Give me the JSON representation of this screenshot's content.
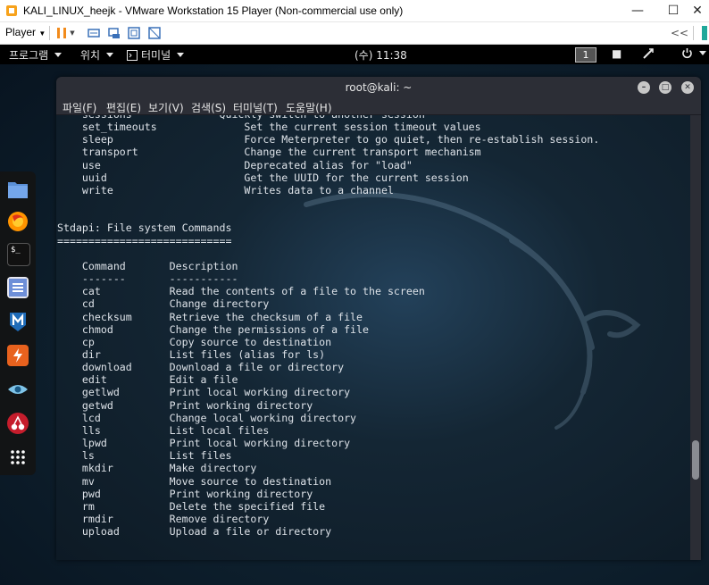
{
  "vmware": {
    "title": "KALI_LINUX_heejk - VMware Workstation 15 Player (Non-commercial use only)",
    "player_label": "Player",
    "icons": [
      "vmware-app-icon",
      "pause-icon",
      "send-ctrl-alt-del-icon",
      "removable-devices-icon",
      "fullscreen-icon",
      "unity-icon",
      "collapse-icon"
    ]
  },
  "gnome": {
    "programs": "프로그램",
    "places": "위치",
    "terminal_app": "터미널",
    "clock": "(수) 11:38",
    "workspace": "1"
  },
  "dock": {
    "icons": [
      "files-icon",
      "firefox-icon",
      "terminal-icon",
      "text-editor-icon",
      "metasploit-icon",
      "burpsuite-icon",
      "eye-icon",
      "cherrytree-icon",
      "app-grid-icon"
    ]
  },
  "terminal": {
    "title": "root@kali: ~",
    "menu": [
      "파일(F)",
      "편집(E)",
      "보기(V)",
      "검색(S)",
      "터미널(T)",
      "도움말(H)"
    ],
    "lines": [
      "    sessions              Quickly switch to another session",
      "    set_timeouts              Set the current session timeout values",
      "    sleep                     Force Meterpreter to go quiet, then re-establish session.",
      "    transport                 Change the current transport mechanism",
      "    use                       Deprecated alias for \"load\"",
      "    uuid                      Get the UUID for the current session",
      "    write                     Writes data to a channel",
      "",
      "",
      "Stdapi: File system Commands",
      "============================",
      "",
      "    Command       Description",
      "    -------       -----------",
      "    cat           Read the contents of a file to the screen",
      "    cd            Change directory",
      "    checksum      Retrieve the checksum of a file",
      "    chmod         Change the permissions of a file",
      "    cp            Copy source to destination",
      "    dir           List files (alias for ls)",
      "    download      Download a file or directory",
      "    edit          Edit a file",
      "    getlwd        Print local working directory",
      "    getwd         Print working directory",
      "    lcd           Change local working directory",
      "    lls           List local files",
      "    lpwd          Print local working directory",
      "    ls            List files",
      "    mkdir         Make directory",
      "    mv            Move source to destination",
      "    pwd           Print working directory",
      "    rm            Delete the specified file",
      "    rmdir         Remove directory",
      "    upload        Upload a file or directory"
    ]
  },
  "colors": {
    "terminal_text": "#dde2e8",
    "gnome_bar": "#000000",
    "terminal_chrome": "#2c2e36"
  }
}
